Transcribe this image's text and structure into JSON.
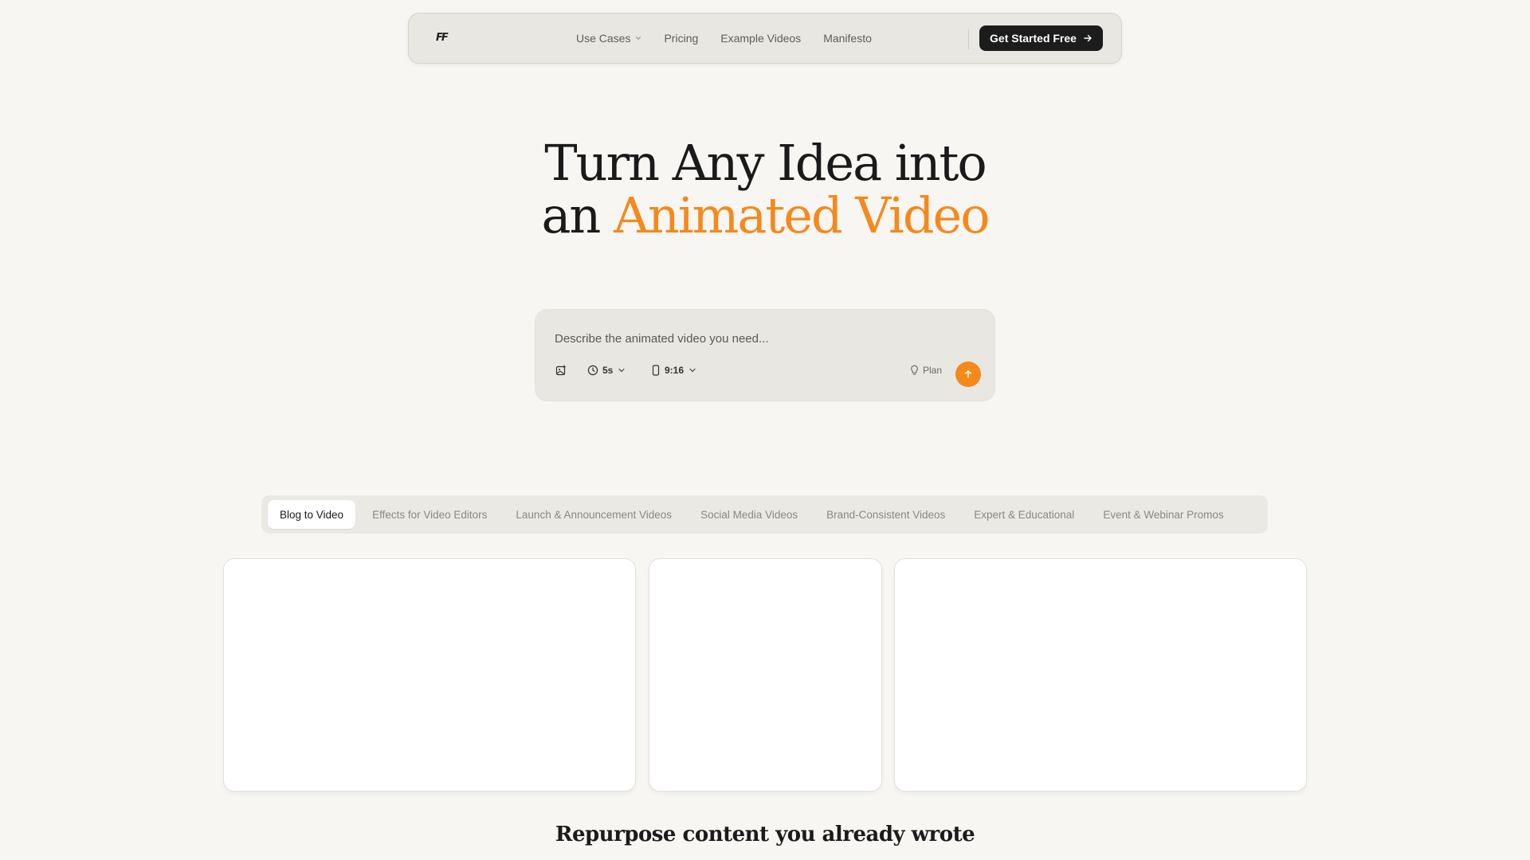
{
  "nav": {
    "logo": "FF",
    "links": [
      {
        "label": "Use Cases",
        "has_dropdown": true
      },
      {
        "label": "Pricing"
      },
      {
        "label": "Example Videos"
      },
      {
        "label": "Manifesto"
      }
    ],
    "cta_label": "Get Started Free"
  },
  "hero": {
    "line1": "Turn Any Idea into",
    "line2_prefix": "an ",
    "line2_accent": "Animated Video",
    "accent_color": "#f5891c"
  },
  "prompt": {
    "placeholder": "Describe the animated video you need...",
    "duration": "5s",
    "aspect_ratio": "9:16",
    "plan_label": "Plan"
  },
  "tabs": [
    {
      "label": "Blog to Video",
      "active": true
    },
    {
      "label": "Effects for Video Editors"
    },
    {
      "label": "Launch & Announcement Videos"
    },
    {
      "label": "Social Media Videos"
    },
    {
      "label": "Brand-Consistent Videos"
    },
    {
      "label": "Expert & Educational"
    },
    {
      "label": "Event & Webinar Promos"
    }
  ],
  "section": {
    "title": "Repurpose content you already wrote"
  }
}
